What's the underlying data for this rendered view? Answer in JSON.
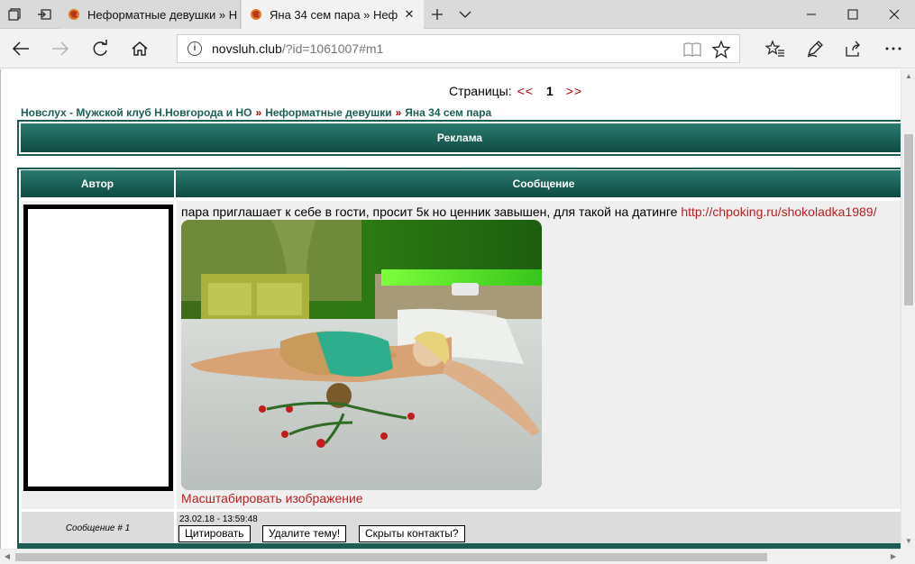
{
  "browser": {
    "tabs": [
      {
        "title": "Неформатные девушки » Н",
        "active": false
      },
      {
        "title": "Яна 34 сем пара » Неф",
        "active": true
      }
    ],
    "url": {
      "host": "novsluh.club",
      "path": "/?id=1061007#m1"
    }
  },
  "page": {
    "pagination": {
      "label": "Страницы:",
      "prev": "<<",
      "current": "1",
      "next": ">>"
    },
    "breadcrumb": {
      "items": [
        "Новслух - Мужской клуб Н.Новгорода и НО",
        "Неформатные девушки",
        "Яна 34 сем пара"
      ],
      "separator": "»"
    },
    "ad_header": "Реклама",
    "post": {
      "author_header": "Автор",
      "message_header": "Сообщение",
      "text": "пара приглашает к себе в гости, просит 5к но ценник завышен, для такой на датинге",
      "link": "http://chpoking.ru/shokoladka1989/",
      "zoom_link": "Масштабировать изображение",
      "message_number": "Сообщение # 1",
      "date": "23.02.18 - 13:59:48",
      "buttons": {
        "quote": "Цитировать",
        "delete": "Удалите тему!",
        "hidden": "Скрыты контакты?"
      }
    }
  },
  "colors": {
    "header_teal": "#1b5d54",
    "link_red": "#b81f1f"
  }
}
